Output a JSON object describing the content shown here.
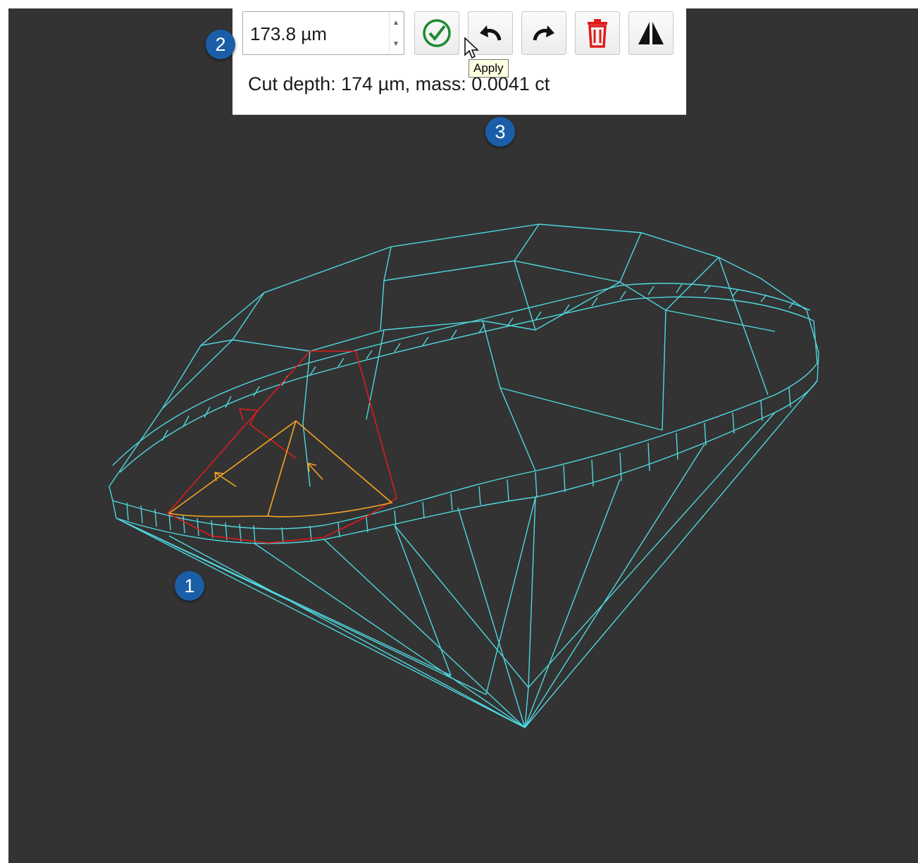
{
  "toolbar": {
    "depth_value": "173.8 µm",
    "buttons": [
      {
        "name": "apply-button",
        "icon": "check-circle-icon",
        "color": "#1e8a2e",
        "tooltip": "Apply"
      },
      {
        "name": "undo-button",
        "icon": "undo-icon",
        "color": "#111111"
      },
      {
        "name": "redo-button",
        "icon": "redo-icon",
        "color": "#111111"
      },
      {
        "name": "delete-button",
        "icon": "trash-icon",
        "color": "#e01b1b"
      },
      {
        "name": "mirror-button",
        "icon": "mirror-icon",
        "color": "#111111"
      }
    ],
    "tooltip": "Apply"
  },
  "status": {
    "text": "Cut depth: 174 µm, mass: 0.0041 ct"
  },
  "callouts": [
    "1",
    "2",
    "3"
  ],
  "colors": {
    "viewport_bg": "#333333",
    "mesh": "#4fd8df",
    "cut_outline": "#e01b1b",
    "cut_region": "#f5a623",
    "callout": "#1a5ea8"
  }
}
